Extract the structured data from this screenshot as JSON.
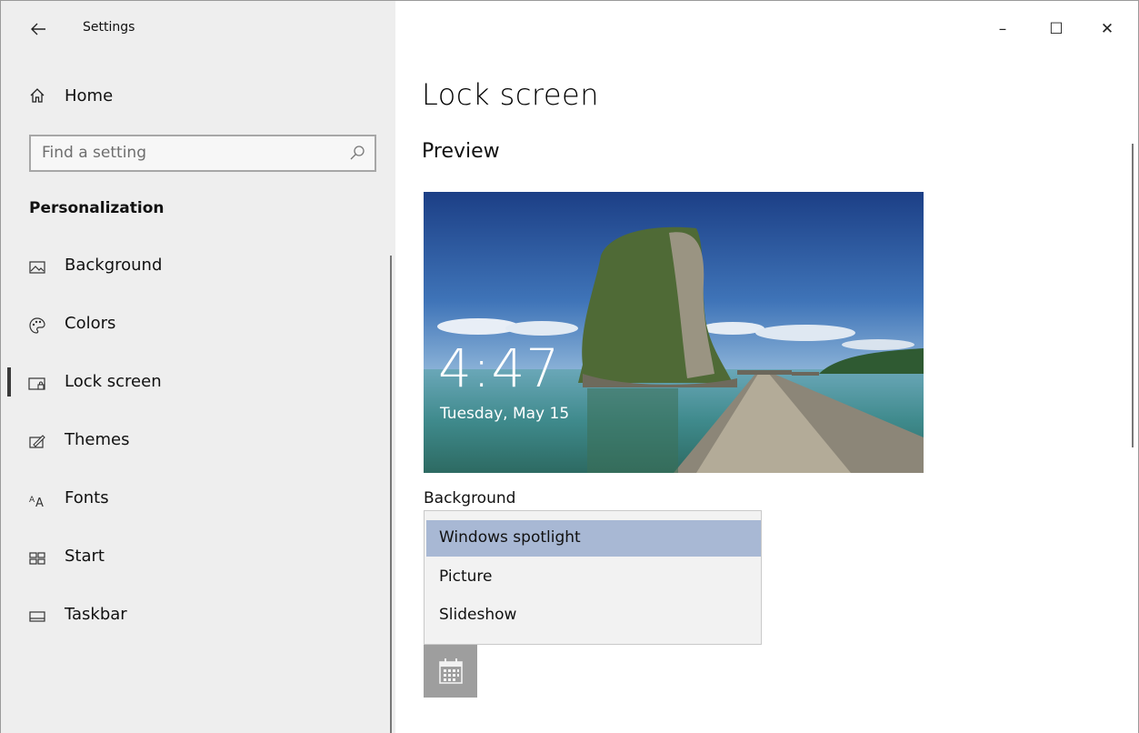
{
  "window": {
    "title": "Settings",
    "controls": {
      "minimize": "–",
      "maximize": "☐",
      "close": "✕"
    }
  },
  "sidebar": {
    "home_label": "Home",
    "search_placeholder": "Find a setting",
    "section_title": "Personalization",
    "items": [
      {
        "label": "Background",
        "icon": "picture-icon",
        "active": false
      },
      {
        "label": "Colors",
        "icon": "palette-icon",
        "active": false
      },
      {
        "label": "Lock screen",
        "icon": "lock-screen-icon",
        "active": true
      },
      {
        "label": "Themes",
        "icon": "themes-icon",
        "active": false
      },
      {
        "label": "Fonts",
        "icon": "fonts-icon",
        "active": false
      },
      {
        "label": "Start",
        "icon": "start-icon",
        "active": false
      },
      {
        "label": "Taskbar",
        "icon": "taskbar-icon",
        "active": false
      }
    ]
  },
  "main": {
    "page_title": "Lock screen",
    "preview_title": "Preview",
    "preview": {
      "time": "4:47",
      "date": "Tuesday, May 15"
    },
    "background_label": "Background",
    "background_options": [
      "Windows spotlight",
      "Picture",
      "Slideshow"
    ],
    "selected_option": "Windows spotlight",
    "app_tile_icon": "calendar-icon"
  },
  "colors": {
    "sidebar_bg": "#eeeeee",
    "selected_option_bg": "#a8b8d4",
    "tile_bg": "#9e9e9e"
  }
}
